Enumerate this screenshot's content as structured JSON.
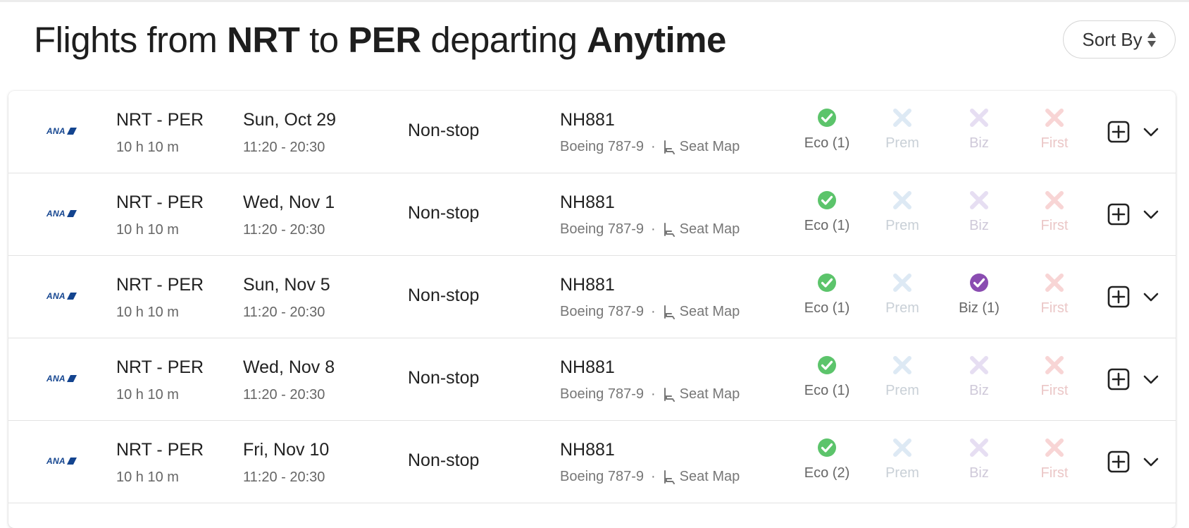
{
  "header": {
    "prefix": "Flights from",
    "origin": "NRT",
    "mid": "to",
    "destination": "PER",
    "departing_word": "departing",
    "when": "Anytime",
    "sort_label": "Sort By"
  },
  "colors": {
    "available_eco": "#5cc46b",
    "available_biz": "#8a4cb1",
    "unavailable_prem": "#dde9f4",
    "unavailable_biz": "#e6def2",
    "unavailable_first": "#f8d5d5",
    "airline_brand": "#13448f"
  },
  "airline": {
    "logo_text": "ANA"
  },
  "flights": [
    {
      "route": "NRT - PER",
      "duration": "10 h 10 m",
      "date": "Sun, Oct 29",
      "times": "11:20 - 20:30",
      "stops": "Non-stop",
      "flight_no": "NH881",
      "aircraft": "Boeing 787-9",
      "seat_map": "Seat Map",
      "cabins": {
        "eco": "Eco (1)",
        "prem": "Prem",
        "biz": "Biz",
        "first": "First"
      },
      "availability": {
        "eco": true,
        "prem": false,
        "biz": false,
        "first": false
      }
    },
    {
      "route": "NRT - PER",
      "duration": "10 h 10 m",
      "date": "Wed, Nov 1",
      "times": "11:20 - 20:30",
      "stops": "Non-stop",
      "flight_no": "NH881",
      "aircraft": "Boeing 787-9",
      "seat_map": "Seat Map",
      "cabins": {
        "eco": "Eco (1)",
        "prem": "Prem",
        "biz": "Biz",
        "first": "First"
      },
      "availability": {
        "eco": true,
        "prem": false,
        "biz": false,
        "first": false
      }
    },
    {
      "route": "NRT - PER",
      "duration": "10 h 10 m",
      "date": "Sun, Nov 5",
      "times": "11:20 - 20:30",
      "stops": "Non-stop",
      "flight_no": "NH881",
      "aircraft": "Boeing 787-9",
      "seat_map": "Seat Map",
      "cabins": {
        "eco": "Eco (1)",
        "prem": "Prem",
        "biz": "Biz (1)",
        "first": "First"
      },
      "availability": {
        "eco": true,
        "prem": false,
        "biz": true,
        "first": false
      }
    },
    {
      "route": "NRT - PER",
      "duration": "10 h 10 m",
      "date": "Wed, Nov 8",
      "times": "11:20 - 20:30",
      "stops": "Non-stop",
      "flight_no": "NH881",
      "aircraft": "Boeing 787-9",
      "seat_map": "Seat Map",
      "cabins": {
        "eco": "Eco (1)",
        "prem": "Prem",
        "biz": "Biz",
        "first": "First"
      },
      "availability": {
        "eco": true,
        "prem": false,
        "biz": false,
        "first": false
      }
    },
    {
      "route": "NRT - PER",
      "duration": "10 h 10 m",
      "date": "Fri, Nov 10",
      "times": "11:20 - 20:30",
      "stops": "Non-stop",
      "flight_no": "NH881",
      "aircraft": "Boeing 787-9",
      "seat_map": "Seat Map",
      "cabins": {
        "eco": "Eco (2)",
        "prem": "Prem",
        "biz": "Biz",
        "first": "First"
      },
      "availability": {
        "eco": true,
        "prem": false,
        "biz": false,
        "first": false
      }
    }
  ]
}
